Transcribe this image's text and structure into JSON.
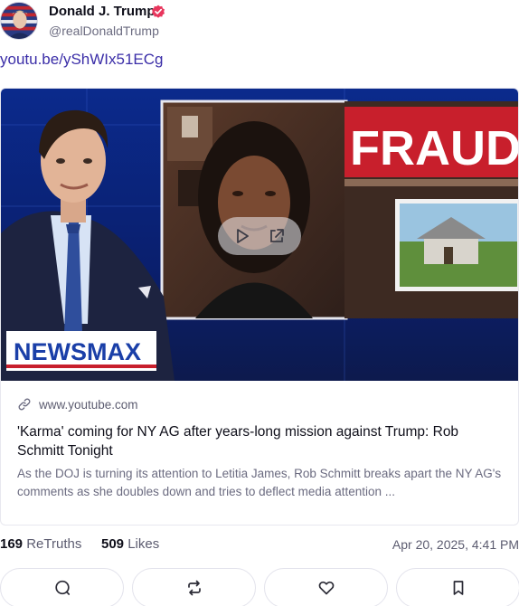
{
  "author": {
    "display_name": "Donald J. Trump",
    "handle": "@realDonaldTrump",
    "avatar_icon": "avatar-flag-portrait",
    "verified_icon": "verified-badge-icon",
    "verified_color": "#e8365d"
  },
  "post": {
    "link_text": "youtu.be/yShWIx51ECg",
    "link_color": "#3b2ea8"
  },
  "link_card": {
    "thumbnail": {
      "overlay_text": "FRAUD",
      "channel_logo": "NEWSMAX",
      "play_icon": "play-icon",
      "external_icon": "external-link-icon"
    },
    "domain": "www.youtube.com",
    "title": "'Karma' coming for NY AG after years-long mission against Trump: Rob Schmitt Tonight",
    "description": "As the DOJ is turning its attention to Letitia James, Rob Schmitt breaks apart the NY AG's comments as she doubles down and tries to deflect media attention ..."
  },
  "stats": {
    "retruths_count": "169",
    "retruths_label": "ReTruths",
    "likes_count": "509",
    "likes_label": "Likes",
    "timestamp": "Apr 20, 2025, 4:41 PM"
  },
  "actions": [
    {
      "name": "reply",
      "icon": "reply-bubble-icon"
    },
    {
      "name": "retruth",
      "icon": "retruth-arrows-icon"
    },
    {
      "name": "like",
      "icon": "heart-icon"
    },
    {
      "name": "bookmark",
      "icon": "bookmark-icon"
    }
  ]
}
